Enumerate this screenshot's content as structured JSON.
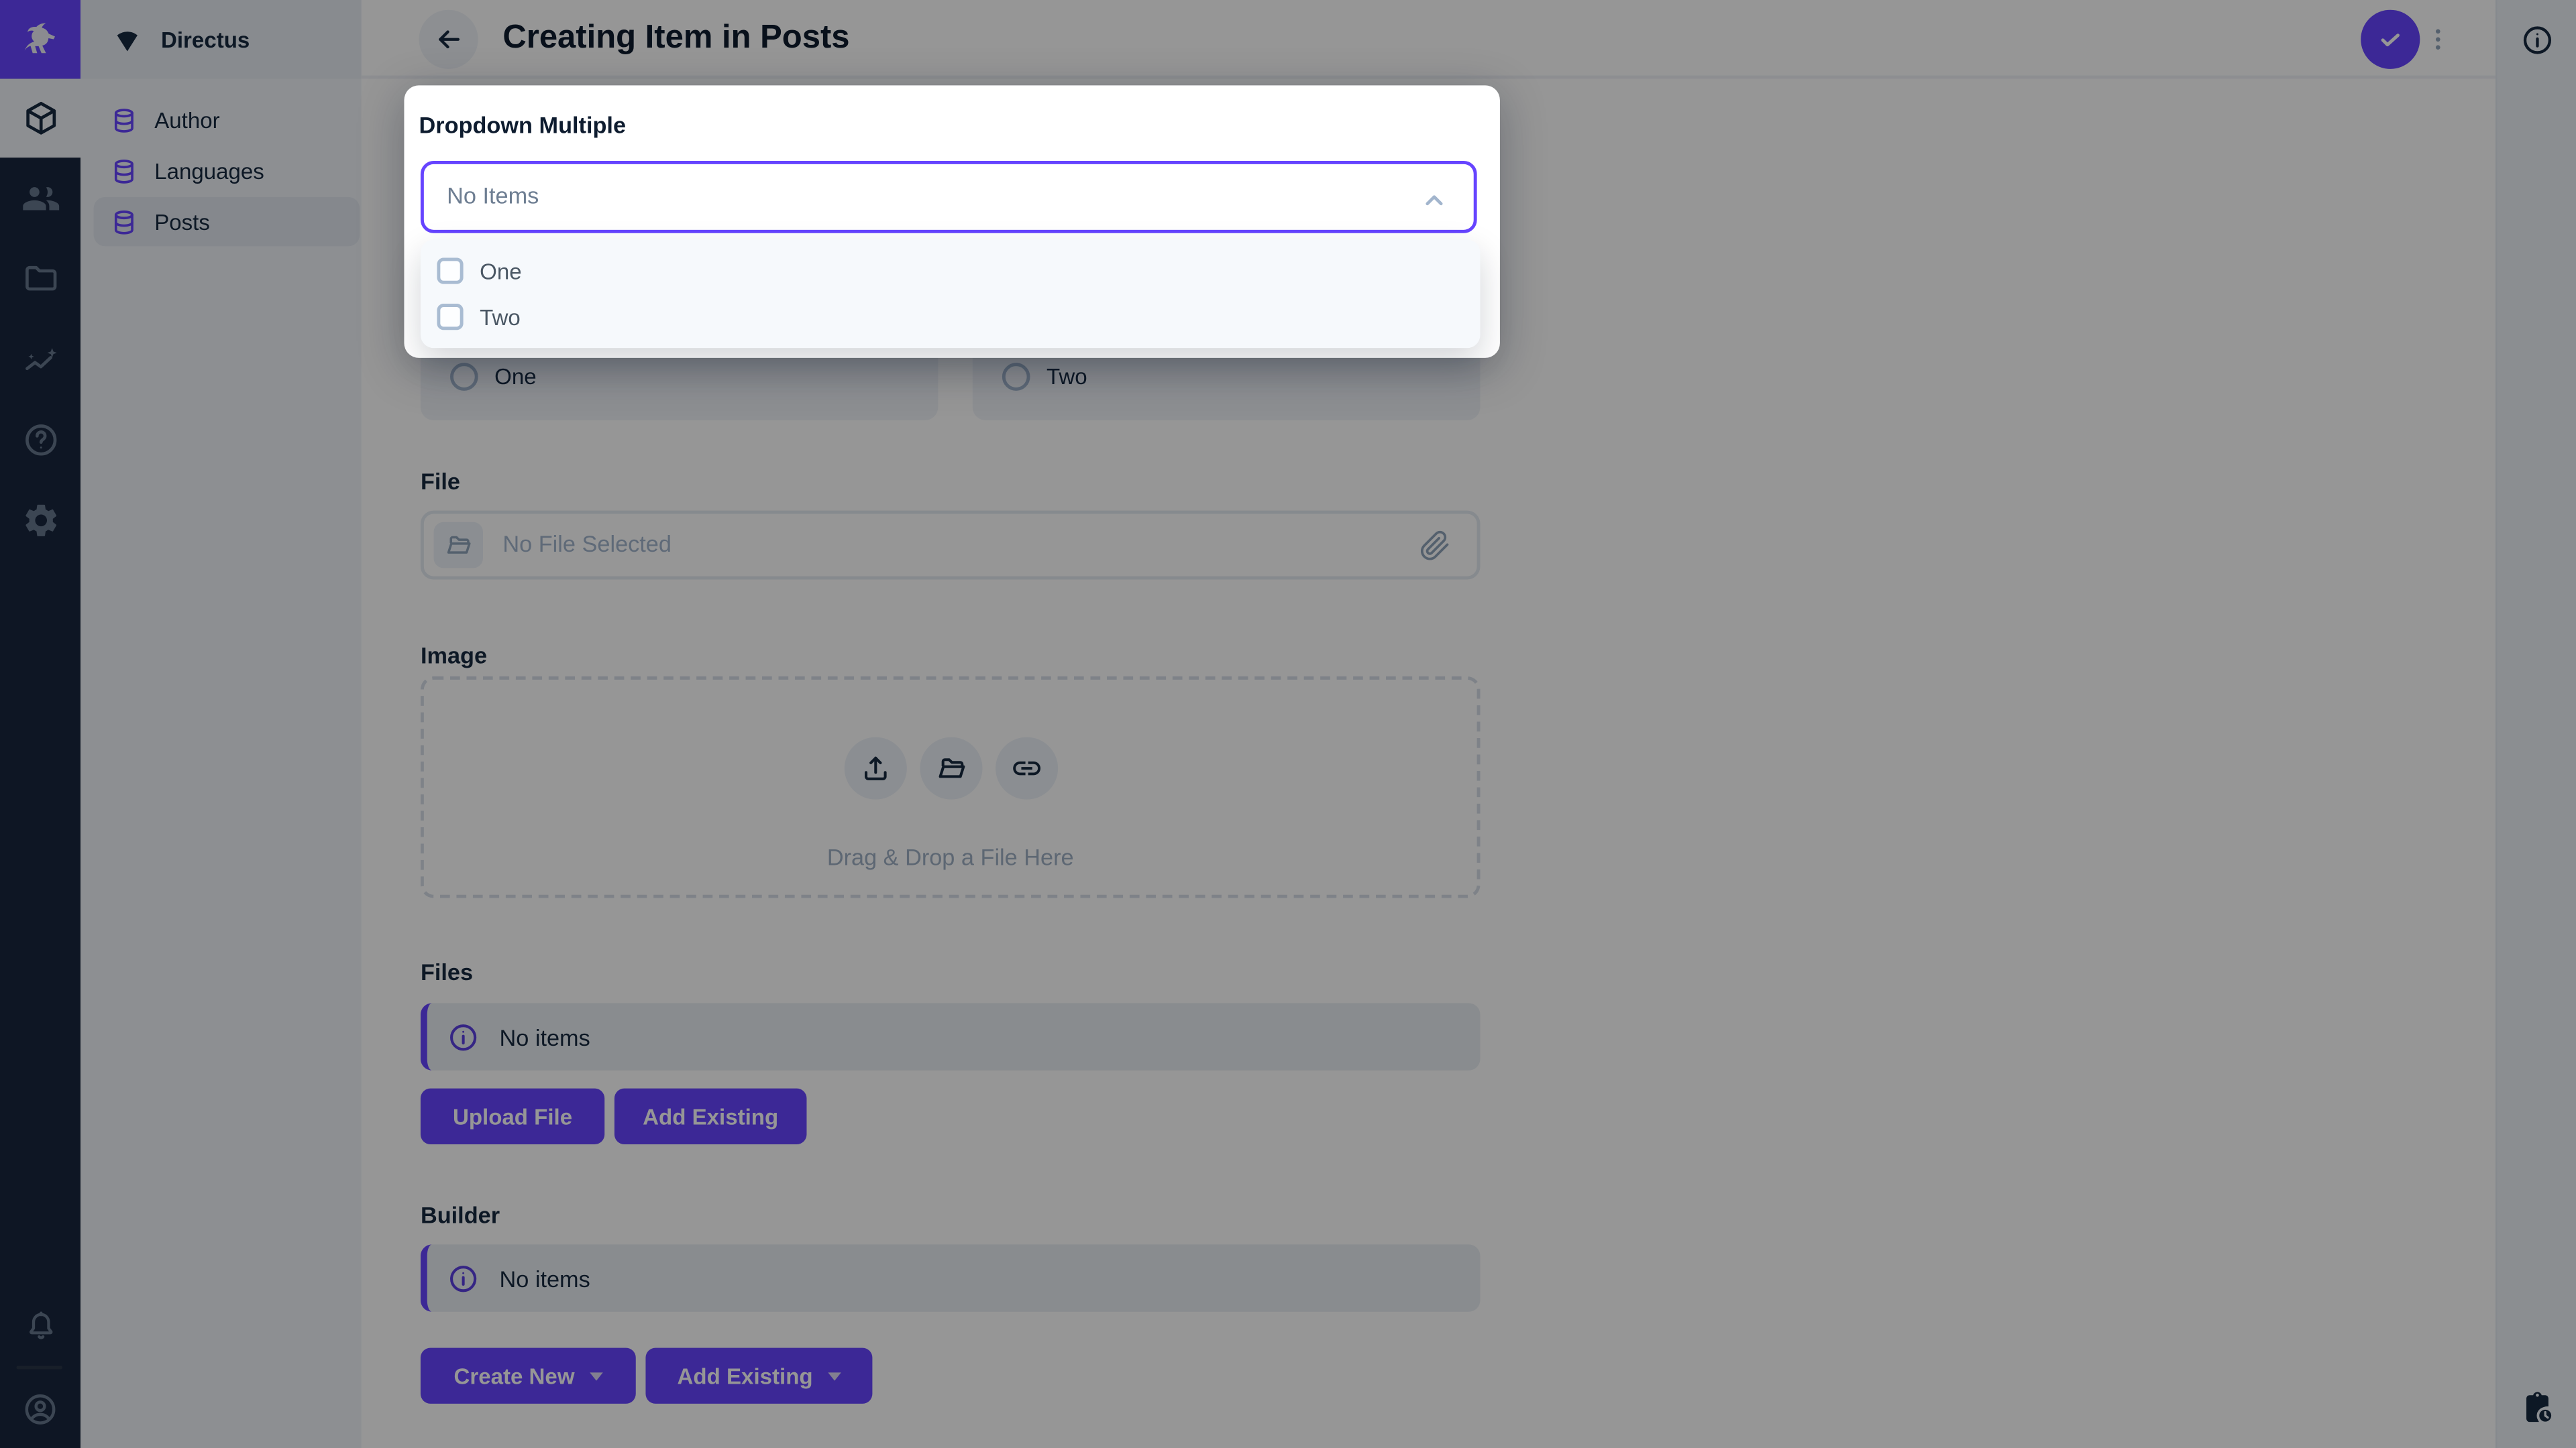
{
  "app": {
    "title": "Creating Item in Posts"
  },
  "module_bar": {
    "logo_icon": "directus-rabbit-icon",
    "icons": [
      "cube-icon",
      "people-icon",
      "folder-icon",
      "insights-icon",
      "help-icon",
      "settings-icon"
    ],
    "active_icon": "cube-icon",
    "bottom_icons": [
      "bell-icon",
      "avatar-icon"
    ]
  },
  "sidebar": {
    "project_name": "Directus",
    "project_icon": "fan-icon",
    "items": [
      {
        "label": "Author",
        "icon": "database-icon",
        "active": false
      },
      {
        "label": "Languages",
        "icon": "database-icon",
        "active": false
      },
      {
        "label": "Posts",
        "icon": "database-icon",
        "active": true
      }
    ]
  },
  "header": {
    "back_icon": "arrow-left-icon",
    "save_icon": "check-icon",
    "menu_icon": "dots-vertical-icon"
  },
  "right_bar": {
    "top_icon": "info-icon",
    "bottom_icon": "clipboard-clock-icon"
  },
  "popover": {
    "label": "Dropdown Multiple",
    "select_value": "No Items",
    "chevron": "chevron-up-icon",
    "options": [
      {
        "label": "One",
        "checked": false
      },
      {
        "label": "Two",
        "checked": false
      }
    ]
  },
  "form": {
    "radio_group": {
      "options": [
        {
          "label": "One",
          "selected": false
        },
        {
          "label": "Two",
          "selected": false
        }
      ]
    },
    "file": {
      "label": "File",
      "placeholder": "No File Selected",
      "icons": [
        "folder-open-icon",
        "paperclip-icon"
      ]
    },
    "image": {
      "label": "Image",
      "dropzone_text": "Drag & Drop a File Here",
      "icons": [
        "upload-icon",
        "folder-open-icon",
        "link-icon"
      ]
    },
    "files": {
      "label": "Files",
      "notice": "No items",
      "notice_icon": "info-icon",
      "buttons": [
        "Upload File",
        "Add Existing"
      ]
    },
    "builder": {
      "label": "Builder",
      "notice": "No items",
      "notice_icon": "info-icon",
      "buttons": [
        "Create New",
        "Add Existing"
      ]
    }
  },
  "colors": {
    "accent": "#6644FF",
    "module_bar_bg": "#18263E",
    "sidebar_bg": "#F0F4F9",
    "text_dark": "#172940",
    "placeholder": "#A2B5CD",
    "overlay": "rgba(0,0,0,0.41)"
  }
}
